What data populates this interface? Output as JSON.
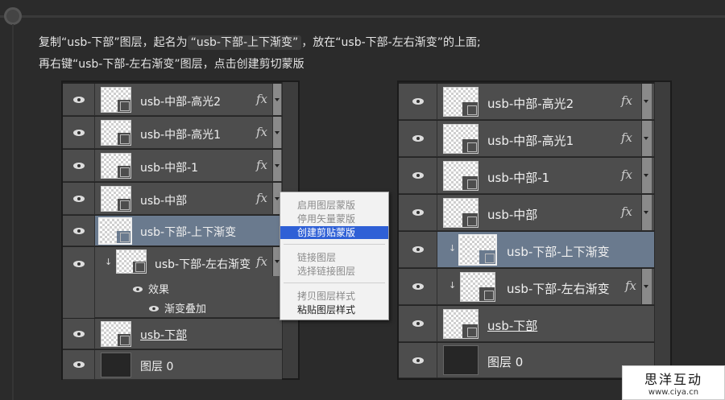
{
  "instructions": {
    "line1_a": "复制“usb-下部”图层，起名为",
    "line1_b": "“usb-下部-上下渐变”",
    "line1_c": "，放在“usb-下部-左右渐变”的上面;",
    "line2": "再右键“usb-下部-左右渐变”图层，点击创建剪切蒙版"
  },
  "left_panel": {
    "layers": [
      {
        "name": "usb-中部-高光2",
        "fx": "fx"
      },
      {
        "name": "usb-中部-高光1",
        "fx": "fx"
      },
      {
        "name": "usb-中部-1",
        "fx": "fx"
      },
      {
        "name": "usb-中部",
        "fx": "fx"
      },
      {
        "name": "usb-下部-上下渐变"
      },
      {
        "name": "usb-下部-左右渐变",
        "fx": "fx"
      },
      {
        "name": "usb-下部"
      },
      {
        "name": "图层 0"
      }
    ],
    "effects_label": "效果",
    "effect_item": "渐变叠加"
  },
  "context_menu": {
    "items": [
      "启用图层蒙版",
      "停用矢量蒙版",
      "创建剪贴蒙版",
      "链接图层",
      "选择链接图层",
      "拷贝图层样式",
      "粘贴图层样式"
    ]
  },
  "right_panel": {
    "layers": [
      {
        "name": "usb-中部-高光2",
        "fx": "fx"
      },
      {
        "name": "usb-中部-高光1",
        "fx": "fx"
      },
      {
        "name": "usb-中部-1",
        "fx": "fx"
      },
      {
        "name": "usb-中部",
        "fx": "fx"
      },
      {
        "name": "usb-下部-上下渐变"
      },
      {
        "name": "usb-下部-左右渐变",
        "fx": "fx"
      },
      {
        "name": "usb-下部"
      },
      {
        "name": "图层 0"
      }
    ]
  },
  "watermark": {
    "title": "思洋互动",
    "url": "www.ciya.cn"
  },
  "colors": {
    "selected_row": "#6a7a8e",
    "menu_highlight": "#2f60d6"
  }
}
